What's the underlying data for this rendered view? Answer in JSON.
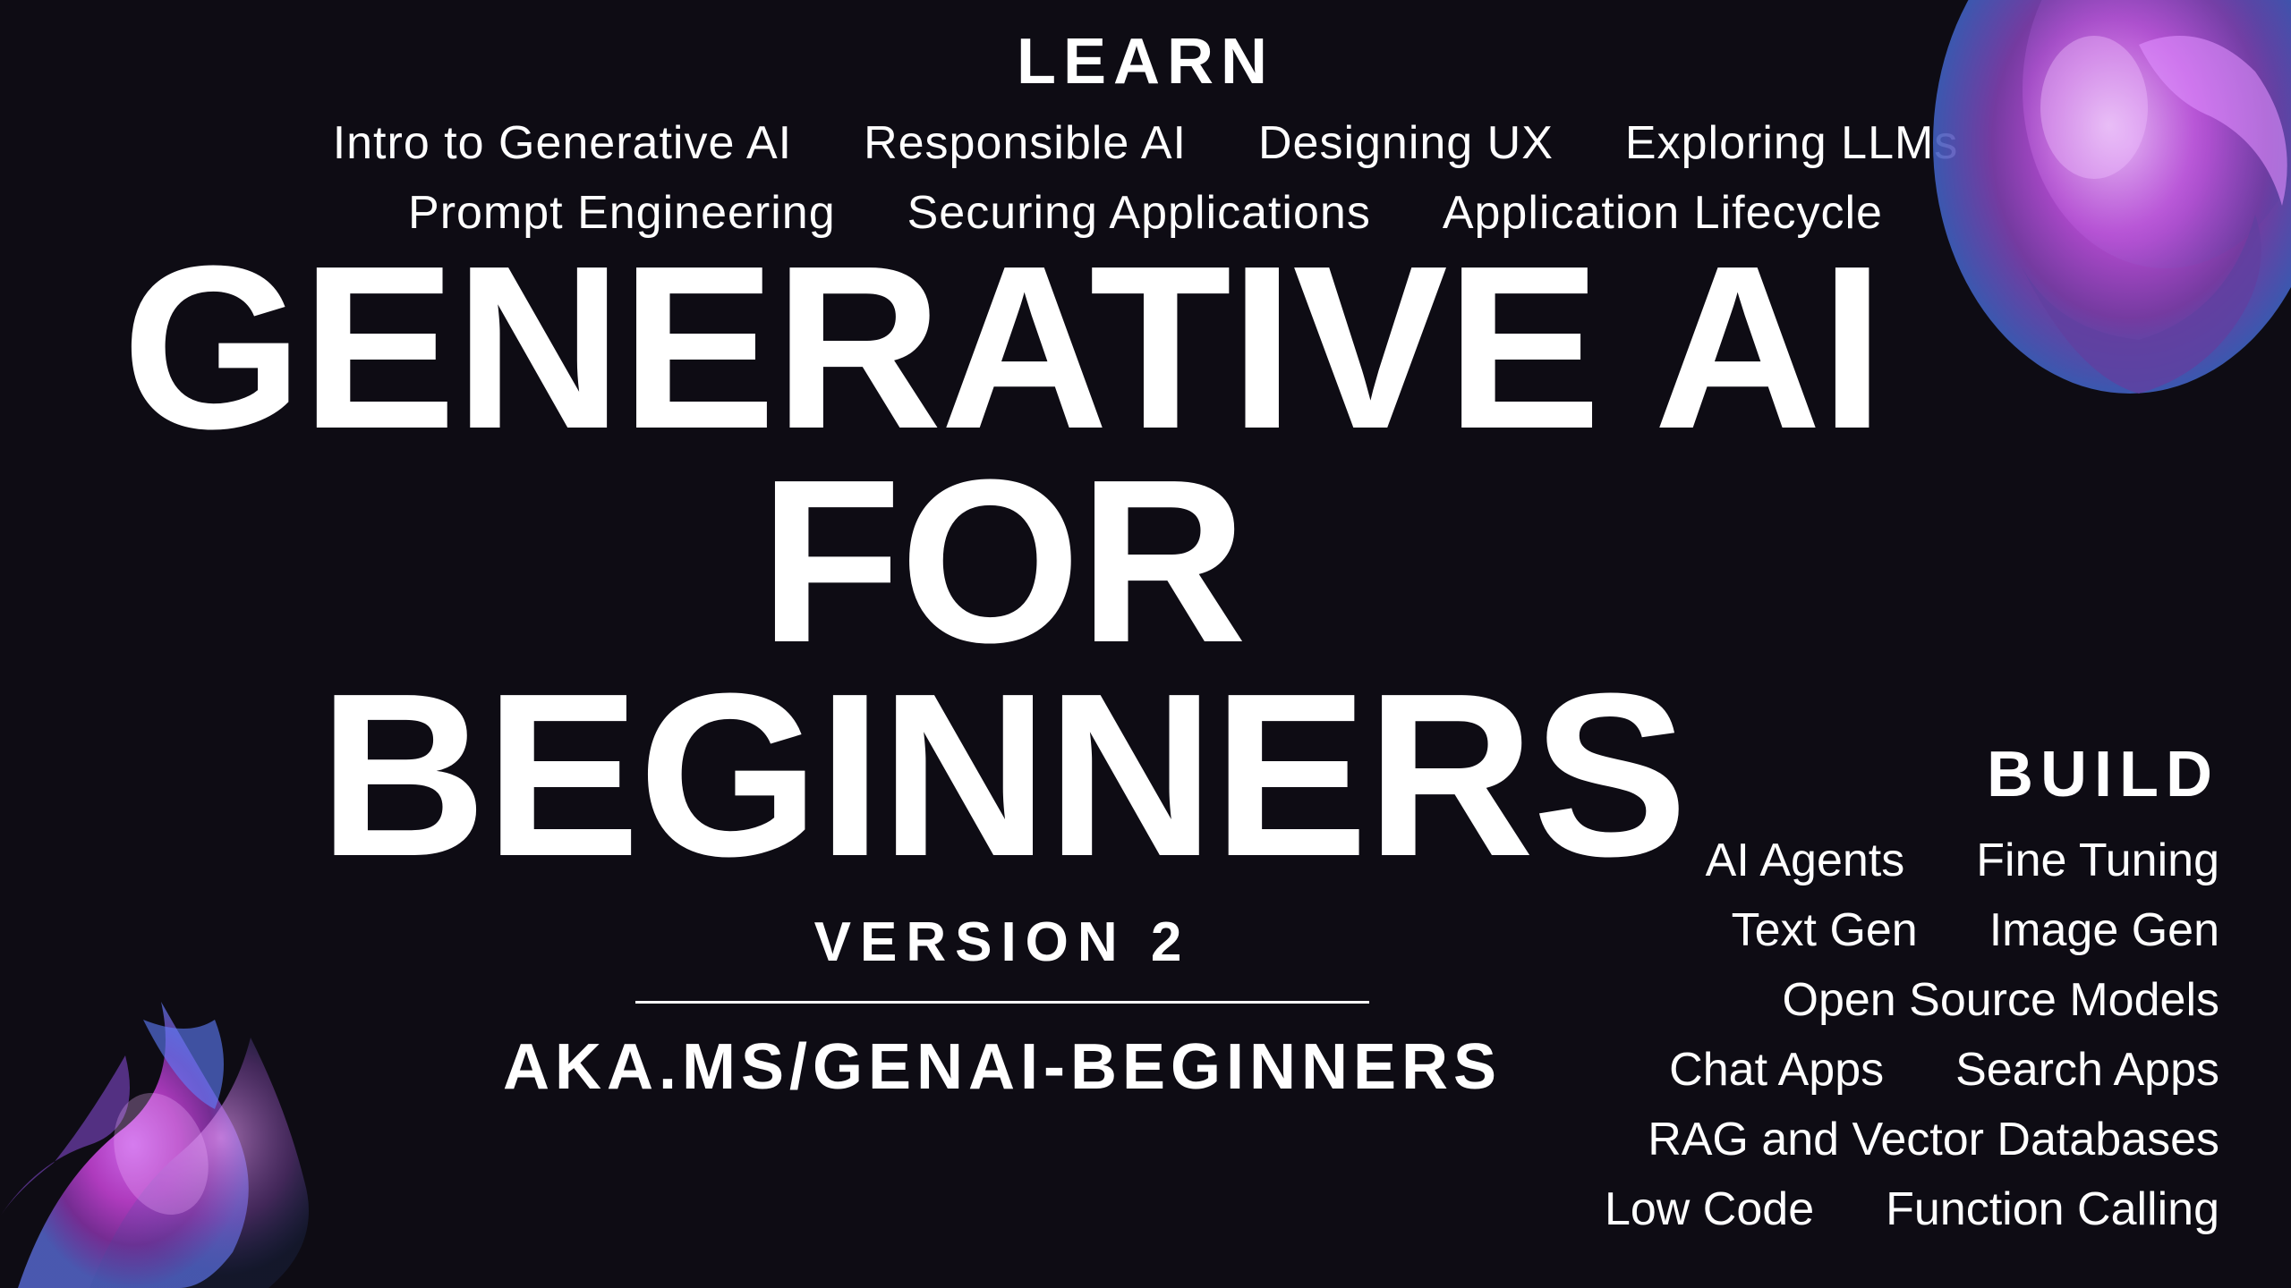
{
  "learn": {
    "label": "LEARN",
    "row1": [
      {
        "text": "Intro to Generative AI"
      },
      {
        "text": "Responsible AI"
      },
      {
        "text": "Designing UX"
      },
      {
        "text": "Exploring LLMs"
      }
    ],
    "row2": [
      {
        "text": "Prompt Engineering"
      },
      {
        "text": "Securing Applications"
      },
      {
        "text": "Application Lifecycle"
      }
    ]
  },
  "main": {
    "title_line1": "GENERATIVE AI",
    "title_line2": "FOR",
    "title_line3": "BEGINNERS",
    "version": "VERSION 2",
    "url": "AKA.MS/GENAI-BEGINNERS"
  },
  "build": {
    "label": "BUILD",
    "row1": [
      {
        "text": "AI Agents"
      },
      {
        "text": "Fine Tuning"
      }
    ],
    "row2": [
      {
        "text": "Text Gen"
      },
      {
        "text": "Image Gen"
      }
    ],
    "row3": [
      {
        "text": "Open Source Models"
      }
    ],
    "row4": [
      {
        "text": "Chat Apps"
      },
      {
        "text": "Search Apps"
      }
    ],
    "row5": [
      {
        "text": "RAG and Vector Databases"
      }
    ],
    "row6": [
      {
        "text": "Low Code"
      },
      {
        "text": "Function Calling"
      }
    ]
  },
  "colors": {
    "background": "#0e0c14",
    "text": "#ffffff",
    "blob_purple": "#c060e0",
    "blob_violet": "#8040c0",
    "blob_blue": "#6080ff"
  }
}
